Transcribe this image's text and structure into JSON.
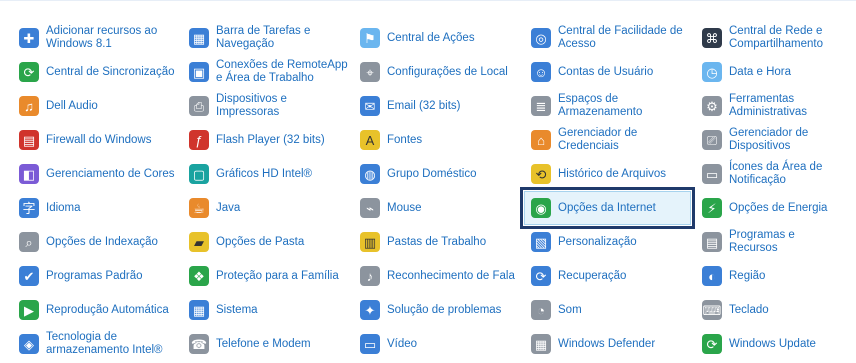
{
  "items": [
    {
      "label": "Adicionar recursos ao Windows 8.1",
      "icon": "windows-feature-icon",
      "color": "c-blue",
      "glyph": "✚"
    },
    {
      "label": "Barra de Tarefas e Navegação",
      "icon": "taskbar-icon",
      "color": "c-blue",
      "glyph": "▦"
    },
    {
      "label": "Central de Ações",
      "icon": "action-center-flag-icon",
      "color": "c-lightblue",
      "glyph": "⚑"
    },
    {
      "label": "Central de Facilidade de Acesso",
      "icon": "ease-of-access-icon",
      "color": "c-blue",
      "glyph": "◎"
    },
    {
      "label": "Central de Rede e Compartilhamento",
      "icon": "network-icon",
      "color": "c-dark",
      "glyph": "⌘"
    },
    {
      "label": "Central de Sincronização",
      "icon": "sync-center-icon",
      "color": "c-green",
      "glyph": "⟳"
    },
    {
      "label": "Conexões de RemoteApp e Área de Trabalho",
      "icon": "remote-desktop-icon",
      "color": "c-blue",
      "glyph": "▣"
    },
    {
      "label": "Configurações de Local",
      "icon": "location-settings-icon",
      "color": "c-gray",
      "glyph": "⌖"
    },
    {
      "label": "Contas de Usuário",
      "icon": "user-accounts-icon",
      "color": "c-blue",
      "glyph": "☺"
    },
    {
      "label": "Data e Hora",
      "icon": "date-time-icon",
      "color": "c-lightblue",
      "glyph": "◷"
    },
    {
      "label": "Dell Audio",
      "icon": "dell-audio-icon",
      "color": "c-orange",
      "glyph": "♫"
    },
    {
      "label": "Dispositivos e Impressoras",
      "icon": "devices-printers-icon",
      "color": "c-gray",
      "glyph": "⎙"
    },
    {
      "label": "Email (32 bits)",
      "icon": "email-icon",
      "color": "c-blue",
      "glyph": "✉"
    },
    {
      "label": "Espaços de Armazenamento",
      "icon": "storage-spaces-icon",
      "color": "c-gray",
      "glyph": "≣"
    },
    {
      "label": "Ferramentas Administrativas",
      "icon": "admin-tools-icon",
      "color": "c-gray",
      "glyph": "⚙"
    },
    {
      "label": "Firewall do Windows",
      "icon": "firewall-icon",
      "color": "c-red",
      "glyph": "▤"
    },
    {
      "label": "Flash Player (32 bits)",
      "icon": "flash-player-icon",
      "color": "c-red",
      "glyph": "ƒ"
    },
    {
      "label": "Fontes",
      "icon": "fonts-icon",
      "color": "c-yellow",
      "glyph": "A"
    },
    {
      "label": "Gerenciador de Credenciais",
      "icon": "credential-manager-icon",
      "color": "c-orange",
      "glyph": "⌂"
    },
    {
      "label": "Gerenciador de Dispositivos",
      "icon": "device-manager-icon",
      "color": "c-gray",
      "glyph": "⎚"
    },
    {
      "label": "Gerenciamento de Cores",
      "icon": "color-management-icon",
      "color": "c-purple",
      "glyph": "◧"
    },
    {
      "label": "Gráficos HD Intel®",
      "icon": "intel-graphics-icon",
      "color": "c-teal",
      "glyph": "▢"
    },
    {
      "label": "Grupo Doméstico",
      "icon": "homegroup-icon",
      "color": "c-blue",
      "glyph": "◍"
    },
    {
      "label": "Histórico de Arquivos",
      "icon": "file-history-icon",
      "color": "c-yellow",
      "glyph": "⟲"
    },
    {
      "label": "Ícones da Área de Notificação",
      "icon": "notification-area-icon",
      "color": "c-gray",
      "glyph": "▭"
    },
    {
      "label": "Idioma",
      "icon": "language-icon",
      "color": "c-blue",
      "glyph": "字"
    },
    {
      "label": "Java",
      "icon": "java-icon",
      "color": "c-orange",
      "glyph": "☕"
    },
    {
      "label": "Mouse",
      "icon": "mouse-icon",
      "color": "c-gray",
      "glyph": "⌁"
    },
    {
      "label": "Opções da Internet",
      "icon": "internet-options-icon",
      "color": "c-green",
      "glyph": "◉"
    },
    {
      "label": "Opções de Energia",
      "icon": "power-options-icon",
      "color": "c-green",
      "glyph": "⚡"
    },
    {
      "label": "Opções de Indexação",
      "icon": "indexing-options-icon",
      "color": "c-gray",
      "glyph": "⌕"
    },
    {
      "label": "Opções de Pasta",
      "icon": "folder-options-icon",
      "color": "c-yellow",
      "glyph": "▰"
    },
    {
      "label": "Pastas de Trabalho",
      "icon": "work-folders-icon",
      "color": "c-yellow",
      "glyph": "▥"
    },
    {
      "label": "Personalização",
      "icon": "personalization-icon",
      "color": "c-blue",
      "glyph": "▧"
    },
    {
      "label": "Programas e Recursos",
      "icon": "programs-features-icon",
      "color": "c-gray",
      "glyph": "▤"
    },
    {
      "label": "Programas Padrão",
      "icon": "default-programs-icon",
      "color": "c-blue",
      "glyph": "✔"
    },
    {
      "label": "Proteção para a Família",
      "icon": "family-safety-icon",
      "color": "c-green",
      "glyph": "❖"
    },
    {
      "label": "Reconhecimento de Fala",
      "icon": "speech-recognition-icon",
      "color": "c-gray",
      "glyph": "♪"
    },
    {
      "label": "Recuperação",
      "icon": "recovery-icon",
      "color": "c-blue",
      "glyph": "⟳"
    },
    {
      "label": "Região",
      "icon": "region-icon",
      "color": "c-blue",
      "glyph": "◐"
    },
    {
      "label": "Reprodução Automática",
      "icon": "autoplay-icon",
      "color": "c-green",
      "glyph": "▶"
    },
    {
      "label": "Sistema",
      "icon": "system-icon",
      "color": "c-blue",
      "glyph": "▦"
    },
    {
      "label": "Solução de problemas",
      "icon": "troubleshooting-icon",
      "color": "c-blue",
      "glyph": "✦"
    },
    {
      "label": "Som",
      "icon": "sound-icon",
      "color": "c-gray",
      "glyph": "◔"
    },
    {
      "label": "Teclado",
      "icon": "keyboard-icon",
      "color": "c-gray",
      "glyph": "⌨"
    },
    {
      "label": "Tecnologia de armazenamento Intel®",
      "icon": "intel-storage-icon",
      "color": "c-blue",
      "glyph": "◈"
    },
    {
      "label": "Telefone e Modem",
      "icon": "phone-modem-icon",
      "color": "c-gray",
      "glyph": "☎"
    },
    {
      "label": "Vídeo",
      "icon": "display-icon",
      "color": "c-blue",
      "glyph": "▭"
    },
    {
      "label": "Windows Defender",
      "icon": "windows-defender-icon",
      "color": "c-gray",
      "glyph": "▦"
    },
    {
      "label": "Windows Update",
      "icon": "windows-update-icon",
      "color": "c-green",
      "glyph": "⟳"
    }
  ],
  "selected_label": "Opções da Internet"
}
